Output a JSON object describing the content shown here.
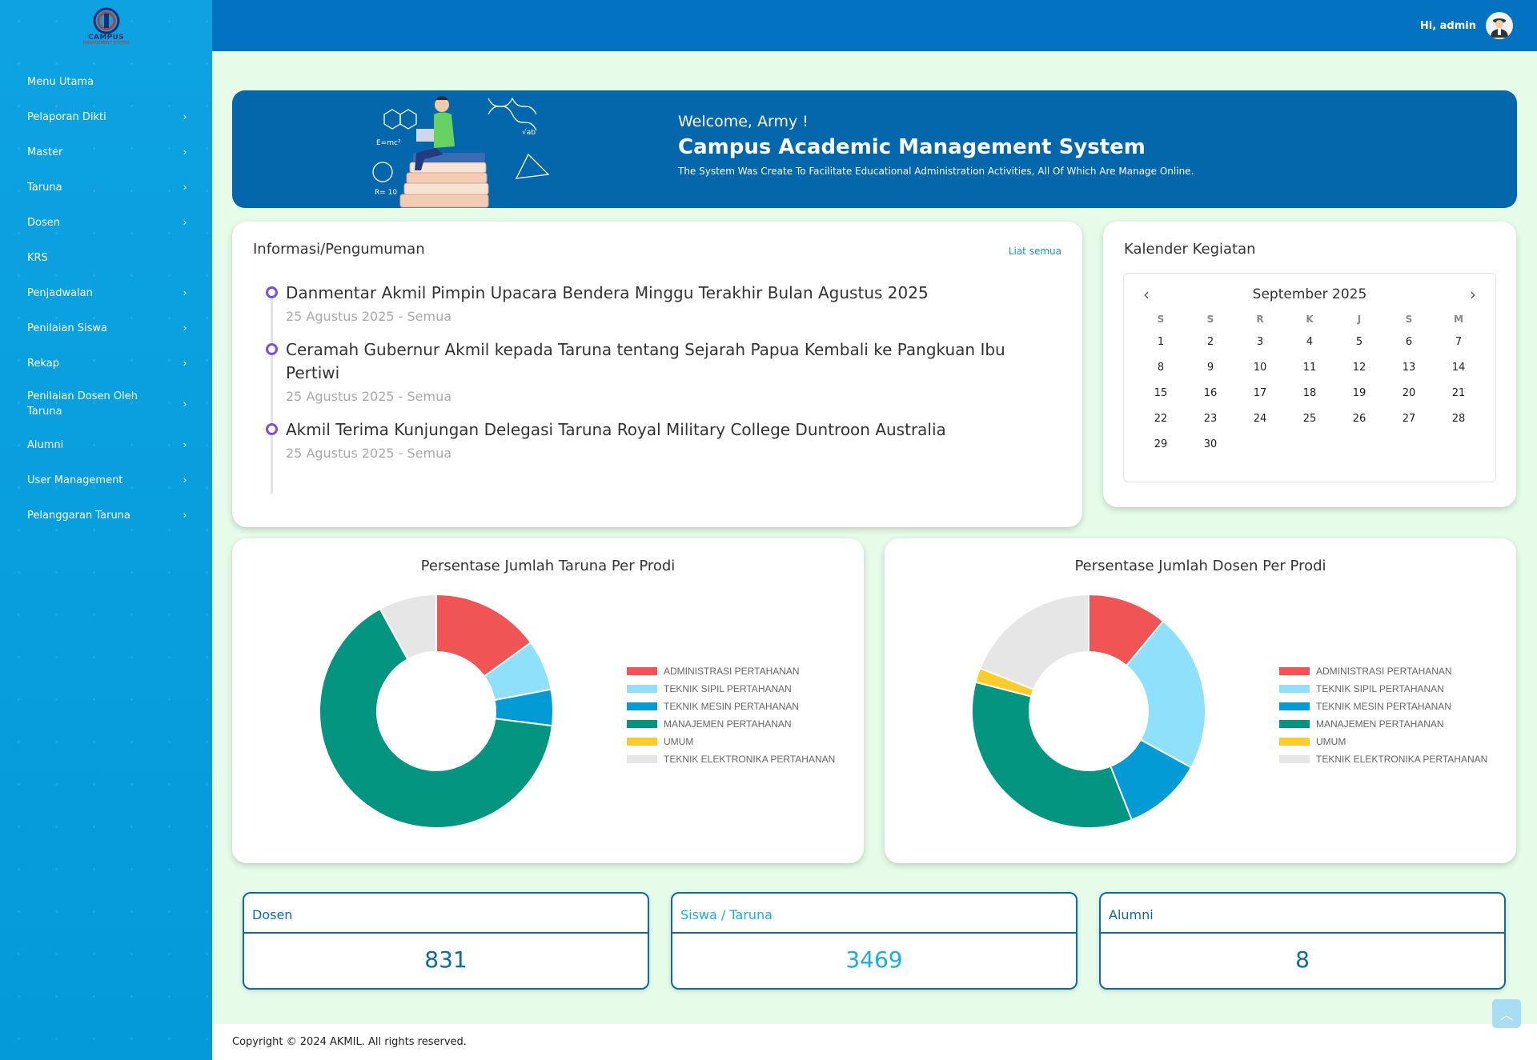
{
  "brand": {
    "logo_text": "CAMPUS",
    "logo_sub": "MANAGEMENT SYSTEM"
  },
  "sidebar": {
    "items": [
      {
        "label": "Menu Utama",
        "has_chevron": false
      },
      {
        "label": "Pelaporan Dikti",
        "has_chevron": true
      },
      {
        "label": "Master",
        "has_chevron": true
      },
      {
        "label": "Taruna",
        "has_chevron": true
      },
      {
        "label": "Dosen",
        "has_chevron": true
      },
      {
        "label": "KRS",
        "has_chevron": false
      },
      {
        "label": "Penjadwalan",
        "has_chevron": true
      },
      {
        "label": "Penilaian Siswa",
        "has_chevron": true
      },
      {
        "label": "Rekap",
        "has_chevron": true
      },
      {
        "label": "Penilaian Dosen Oleh Taruna",
        "has_chevron": true
      },
      {
        "label": "Alumni",
        "has_chevron": true
      },
      {
        "label": "User Management",
        "has_chevron": true
      },
      {
        "label": "Pelanggaran Taruna",
        "has_chevron": true
      }
    ]
  },
  "header": {
    "greeting": "Hi, admin"
  },
  "banner": {
    "welcome": "Welcome, Army !",
    "title": "Campus Academic Management System",
    "subtitle": "The System Was Create To Facilitate Educational Administration Activities, All Of Which Are Manage Online."
  },
  "info": {
    "title": "Informasi/Pengumuman",
    "see_all": "Liat semua",
    "items": [
      {
        "title": "Danmentar Akmil Pimpin Upacara Bendera Minggu Terakhir Bulan Agustus 2025",
        "meta": "25 Agustus 2025 - Semua"
      },
      {
        "title": "Ceramah Gubernur Akmil kepada Taruna tentang Sejarah Papua Kembali ke Pangkuan Ibu Pertiwi",
        "meta": "25 Agustus 2025 - Semua"
      },
      {
        "title": "Akmil Terima Kunjungan Delegasi Taruna Royal Military College Duntroon Australia",
        "meta": "25 Agustus 2025 - Semua"
      }
    ]
  },
  "calendar": {
    "title": "Kalender Kegiatan",
    "month": "September 2025",
    "prev_icon": "‹",
    "next_icon": "›",
    "weekdays": [
      "S",
      "S",
      "R",
      "K",
      "J",
      "S",
      "M"
    ],
    "days": [
      "1",
      "2",
      "3",
      "4",
      "5",
      "6",
      "7",
      "8",
      "9",
      "10",
      "11",
      "12",
      "13",
      "14",
      "15",
      "16",
      "17",
      "18",
      "19",
      "20",
      "21",
      "22",
      "23",
      "24",
      "25",
      "26",
      "27",
      "28",
      "29",
      "30"
    ]
  },
  "chart_data": [
    {
      "type": "pie",
      "title": "Persentase Jumlah Taruna Per Prodi",
      "categories": [
        "ADMINISTRASI PERTAHANAN",
        "TEKNIK SIPIL PERTAHANAN",
        "TEKNIK MESIN PERTAHANAN",
        "MANAJEMEN PERTAHANAN",
        "UMUM",
        "TEKNIK ELEKTRONIKA PERTAHANAN"
      ],
      "values": [
        15,
        7,
        5,
        65,
        0,
        8
      ],
      "colors": [
        "#f05454",
        "#8fe0fb",
        "#039bd6",
        "#03957f",
        "#fccc2c",
        "#e6e6e6"
      ],
      "legend": "right",
      "donut": true
    },
    {
      "type": "pie",
      "title": "Persentase Jumlah Dosen Per Prodi",
      "categories": [
        "ADMINISTRASI PERTAHANAN",
        "TEKNIK SIPIL PERTAHANAN",
        "TEKNIK MESIN PERTAHANAN",
        "MANAJEMEN PERTAHANAN",
        "UMUM",
        "TEKNIK ELEKTRONIKA PERTAHANAN"
      ],
      "values": [
        11,
        22,
        11,
        35,
        2,
        19
      ],
      "colors": [
        "#f05454",
        "#8fe0fb",
        "#039bd6",
        "#03957f",
        "#fccc2c",
        "#e6e6e6"
      ],
      "legend": "right",
      "donut": true
    }
  ],
  "stats": [
    {
      "label": "Dosen",
      "value": "831",
      "color": "#0b6aa8"
    },
    {
      "label": "Siswa / Taruna",
      "value": "3469",
      "color": "#17aee0"
    },
    {
      "label": "Alumni",
      "value": "8",
      "color": "#0b6aa8"
    }
  ],
  "footer": {
    "text": "Copyright  © 2024 AKMIL.   All rights reserved."
  },
  "icons": {
    "back_to_top": "chevron-up-icon",
    "chevron": "chevron-right-icon"
  }
}
